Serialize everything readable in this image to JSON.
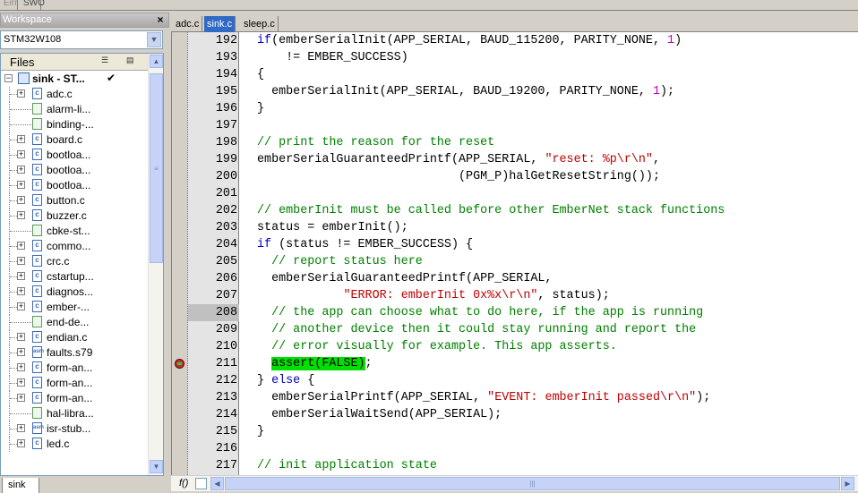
{
  "top_tabs": [
    "Eirr",
    "SWO"
  ],
  "workspace": {
    "title": "Workspace",
    "close_glyph": "×",
    "config": "STM32W108",
    "files_header": "Files",
    "root": {
      "name": "sink - ST...",
      "check": "✔"
    },
    "files": [
      {
        "name": "adc.c",
        "type": "c",
        "expandable": true
      },
      {
        "name": "alarm-li...",
        "type": "plain",
        "expandable": false
      },
      {
        "name": "binding-...",
        "type": "plain",
        "expandable": false
      },
      {
        "name": "board.c",
        "type": "c",
        "expandable": true
      },
      {
        "name": "bootloa...",
        "type": "c",
        "expandable": true
      },
      {
        "name": "bootloa...",
        "type": "c",
        "expandable": true
      },
      {
        "name": "bootloa...",
        "type": "c",
        "expandable": true
      },
      {
        "name": "button.c",
        "type": "c",
        "expandable": true
      },
      {
        "name": "buzzer.c",
        "type": "c",
        "expandable": true
      },
      {
        "name": "cbke-st...",
        "type": "plain",
        "expandable": false
      },
      {
        "name": "commo...",
        "type": "c",
        "expandable": true
      },
      {
        "name": "crc.c",
        "type": "c",
        "expandable": true
      },
      {
        "name": "cstartup...",
        "type": "c",
        "expandable": true
      },
      {
        "name": "diagnos...",
        "type": "c",
        "expandable": true
      },
      {
        "name": "ember-...",
        "type": "c",
        "expandable": true
      },
      {
        "name": "end-de...",
        "type": "plain",
        "expandable": false
      },
      {
        "name": "endian.c",
        "type": "c",
        "expandable": true
      },
      {
        "name": "faults.s79",
        "type": "asm",
        "expandable": true
      },
      {
        "name": "form-an...",
        "type": "c",
        "expandable": true
      },
      {
        "name": "form-an...",
        "type": "c",
        "expandable": true
      },
      {
        "name": "form-an...",
        "type": "c",
        "expandable": true
      },
      {
        "name": "hal-libra...",
        "type": "plain",
        "expandable": false
      },
      {
        "name": "isr-stub...",
        "type": "asm",
        "expandable": true
      },
      {
        "name": "led.c",
        "type": "c",
        "expandable": true
      }
    ],
    "bottom_tab": "sink"
  },
  "editor": {
    "tabs": [
      {
        "label": "adc.c",
        "active": false
      },
      {
        "label": "sink.c",
        "active": true
      },
      {
        "label": "sleep.c",
        "active": false
      }
    ],
    "fx_label": "f()",
    "highlighted_line": 208,
    "breakpoint_line": 211,
    "lines": [
      {
        "n": "192",
        "parts": [
          [
            "kw",
            "if"
          ],
          [
            "",
            "(emberSerialInit(APP_SERIAL, BAUD_115200, PARITY_NONE, "
          ],
          [
            "nu",
            "1"
          ],
          [
            "",
            ")"
          ]
        ]
      },
      {
        "n": "193",
        "parts": [
          [
            "",
            "    != EMBER_SUCCESS)"
          ]
        ]
      },
      {
        "n": "194",
        "parts": [
          [
            "",
            "{"
          ]
        ]
      },
      {
        "n": "195",
        "parts": [
          [
            "",
            "  emberSerialInit(APP_SERIAL, BAUD_19200, PARITY_NONE, "
          ],
          [
            "nu",
            "1"
          ],
          [
            "",
            ");"
          ]
        ]
      },
      {
        "n": "196",
        "parts": [
          [
            "",
            "}"
          ]
        ]
      },
      {
        "n": "197",
        "parts": []
      },
      {
        "n": "198",
        "parts": [
          [
            "cm",
            "// print the reason for the reset"
          ]
        ]
      },
      {
        "n": "199",
        "parts": [
          [
            "",
            "emberSerialGuaranteedPrintf(APP_SERIAL, "
          ],
          [
            "st",
            "\"reset: %p\\r\\n\""
          ],
          [
            "",
            ","
          ]
        ]
      },
      {
        "n": "200",
        "parts": [
          [
            "",
            "                            (PGM_P)halGetResetString());"
          ]
        ]
      },
      {
        "n": "201",
        "parts": []
      },
      {
        "n": "202",
        "parts": [
          [
            "cm",
            "// emberInit must be called before other EmberNet stack functions"
          ]
        ]
      },
      {
        "n": "203",
        "parts": [
          [
            "",
            "status = emberInit();"
          ]
        ]
      },
      {
        "n": "204",
        "parts": [
          [
            "kw",
            "if"
          ],
          [
            "",
            " (status != EMBER_SUCCESS) {"
          ]
        ]
      },
      {
        "n": "205",
        "parts": [
          [
            "cm",
            "  // report status here"
          ]
        ]
      },
      {
        "n": "206",
        "parts": [
          [
            "",
            "  emberSerialGuaranteedPrintf(APP_SERIAL,"
          ]
        ]
      },
      {
        "n": "207",
        "parts": [
          [
            "",
            "            "
          ],
          [
            "st",
            "\"ERROR: emberInit 0x%x\\r\\n\""
          ],
          [
            "",
            ", status);"
          ]
        ]
      },
      {
        "n": "208",
        "parts": [
          [
            "cm",
            "  // the app can choose what to do here, if the app is running"
          ]
        ]
      },
      {
        "n": "209",
        "parts": [
          [
            "cm",
            "  // another device then it could stay running and report the"
          ]
        ]
      },
      {
        "n": "210",
        "parts": [
          [
            "cm",
            "  // error visually for example. This app asserts."
          ]
        ]
      },
      {
        "n": "211",
        "parts": [
          [
            "",
            "  "
          ],
          [
            "hlg",
            "assert(FALSE)"
          ],
          [
            "",
            ";"
          ]
        ]
      },
      {
        "n": "212",
        "parts": [
          [
            "",
            "} "
          ],
          [
            "kw",
            "else"
          ],
          [
            "",
            " {"
          ]
        ]
      },
      {
        "n": "213",
        "parts": [
          [
            "",
            "  emberSerialPrintf(APP_SERIAL, "
          ],
          [
            "st",
            "\"EVENT: emberInit passed\\r\\n\""
          ],
          [
            "",
            ");"
          ]
        ]
      },
      {
        "n": "214",
        "parts": [
          [
            "",
            "  emberSerialWaitSend(APP_SERIAL);"
          ]
        ]
      },
      {
        "n": "215",
        "parts": [
          [
            "",
            "}"
          ]
        ]
      },
      {
        "n": "216",
        "parts": []
      },
      {
        "n": "217",
        "parts": [
          [
            "cm",
            "// init application state"
          ]
        ]
      }
    ]
  }
}
